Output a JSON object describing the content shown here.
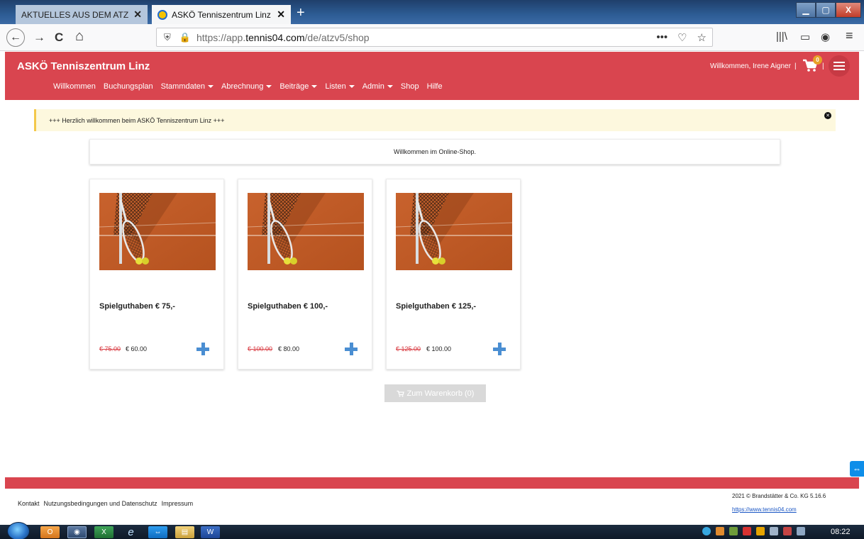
{
  "browser": {
    "tabs": [
      {
        "title": "AKTUELLES AUS DEM ATZ - atz",
        "active": false
      },
      {
        "title": "ASKÖ Tenniszentrum Linz - Che",
        "active": true
      }
    ],
    "url_prefix": "https://app.",
    "url_domain": "tennis04.com",
    "url_path": "/de/atzv5/shop",
    "icons": {
      "back": "←",
      "forward": "→",
      "reload": "C",
      "home": "⌂",
      "more": "•••",
      "pocket": "♡",
      "bookmark": "☆",
      "library": "|||\\",
      "sidebar": "▭",
      "account": "◉",
      "menu": "≡",
      "shield": "⛨",
      "lock": "🔒",
      "new_tab": "+",
      "close": "✕",
      "minimize": "▁",
      "maximize": "▢",
      "win_close": "X"
    }
  },
  "app": {
    "brand": "ASKÖ Tenniszentrum Linz",
    "menu": [
      {
        "label": "Willkommen",
        "dropdown": false
      },
      {
        "label": "Buchungsplan",
        "dropdown": false
      },
      {
        "label": "Stammdaten",
        "dropdown": true
      },
      {
        "label": "Abrechnung",
        "dropdown": true
      },
      {
        "label": "Beiträge",
        "dropdown": true
      },
      {
        "label": "Listen",
        "dropdown": true
      },
      {
        "label": "Admin",
        "dropdown": true
      },
      {
        "label": "Shop",
        "dropdown": false
      },
      {
        "label": "Hilfe",
        "dropdown": false
      }
    ],
    "welcome_text": "Willkommen, Irene Aigner",
    "separator": "|",
    "cart_count": "0",
    "brand_color": "#d9454f"
  },
  "notice": {
    "text": "+++ Herzlich willkommen beim ASKÖ Tenniszentrum Linz +++",
    "close_icon": "✕"
  },
  "shop": {
    "intro": "Willkommen im Online-Shop.",
    "products": [
      {
        "title": "Spielguthaben € 75,-",
        "old_price": "€ 75.00",
        "price": "€ 60.00"
      },
      {
        "title": "Spielguthaben € 100,-",
        "old_price": "€ 100.00",
        "price": "€ 80.00"
      },
      {
        "title": "Spielguthaben € 125,-",
        "old_price": "€ 125.00",
        "price": "€ 100.00"
      }
    ],
    "cart_button": "Zum Warenkorb (0)"
  },
  "footer": {
    "links": [
      "Kontakt",
      "Nutzungsbedingungen und Datenschutz",
      "Impressum"
    ],
    "copyright": "2021 © Brandstätter & Co. KG  5.16.6",
    "url": "https://www.tennis04.com"
  },
  "taskbar": {
    "clock": "08:22"
  }
}
